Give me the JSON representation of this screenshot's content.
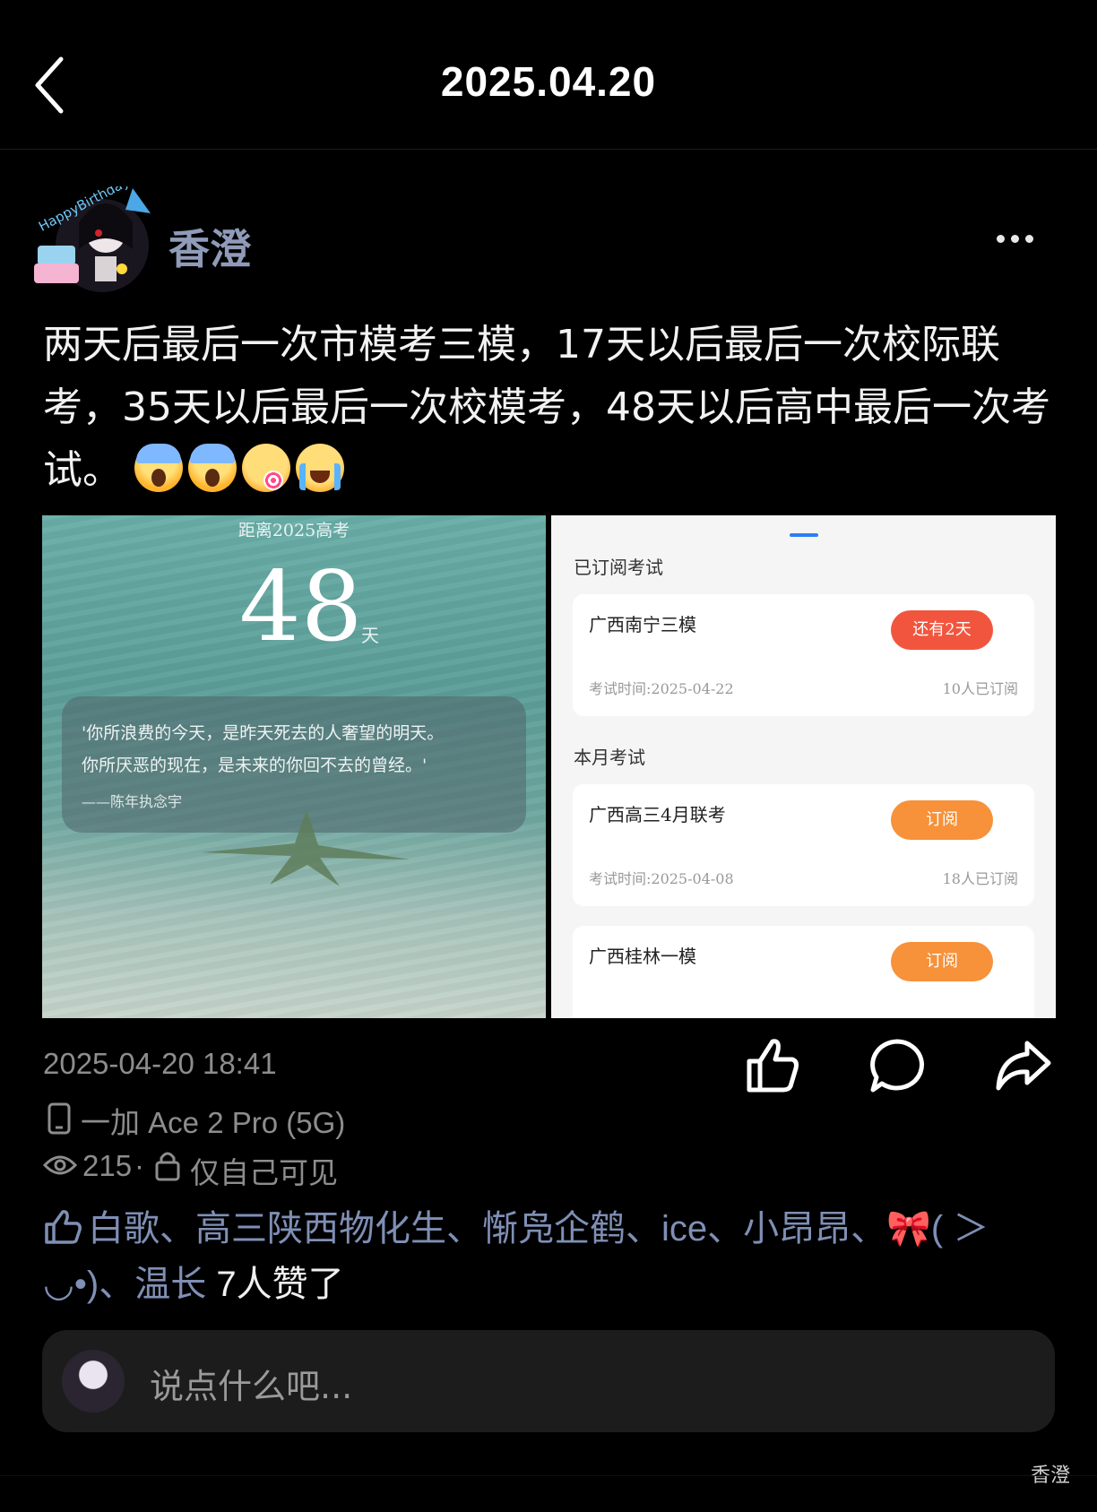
{
  "header": {
    "title": "2025.04.20"
  },
  "post": {
    "username": "香澄",
    "text": "两天后最后一次市模考三模，17天以后最后一次校际联考，35天以后最后一次校模考，48天以后高中最后一次考试。",
    "emojis": [
      "face-screaming-in-fear",
      "face-screaming-in-fear",
      "face-savoring-food",
      "loudly-crying-face"
    ],
    "avatar_text": "HappyBirthday"
  },
  "image1": {
    "countdown_label": "距离2025高考",
    "countdown_number": "48",
    "countdown_unit": "天",
    "quote_line1": "'你所浪费的今天，是昨天死去的人奢望的明天。",
    "quote_line2": "你所厌恶的现在，是未来的你回不去的曾经。'",
    "quote_author": "——陈年执念宇"
  },
  "image2": {
    "section1": "已订阅考试",
    "section2": "本月考试",
    "cards": [
      {
        "name": "广西南宁三模",
        "button": "还有2天",
        "time": "考试时间:2025-04-22",
        "subs": "10人已订阅"
      },
      {
        "name": "广西高三4月联考",
        "button": "订阅",
        "time": "考试时间:2025-04-08",
        "subs": "18人已订阅"
      },
      {
        "name": "广西桂林一模",
        "button": "订阅",
        "time": "",
        "subs": ""
      }
    ]
  },
  "meta": {
    "datetime": "2025-04-20 18:41",
    "device": "一加 Ace 2 Pro (5G)",
    "views": "215",
    "separator": "·",
    "visibility": "仅自己可见"
  },
  "likes": {
    "names": "白歌、高三陕西物化生、惭凫企鹤、ice、小昂昂、🎀( ＞◡•)、温长",
    "count_text": "7人赞了"
  },
  "comment": {
    "placeholder": "说点什么吧..."
  },
  "watermark": "香澄",
  "colors": {
    "background": "#000000",
    "username": "#8f9bb8",
    "accent_blue": "#2d7df6",
    "pill_red": "#f2553e",
    "pill_orange": "#f7913a"
  }
}
